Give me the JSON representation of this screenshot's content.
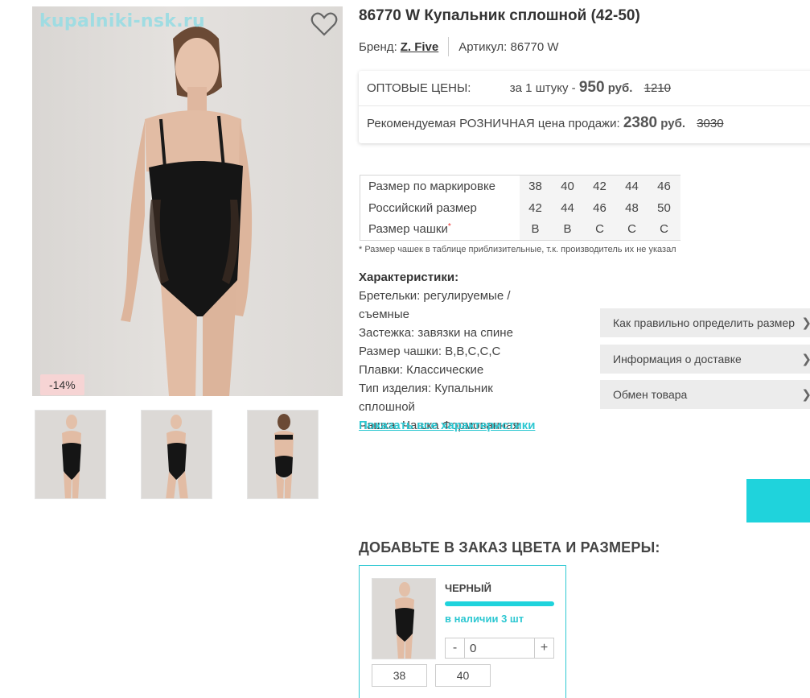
{
  "gallery": {
    "watermark": "kupalniki-nsk.ru",
    "discount_badge": "-14%",
    "thumbnails": [
      "front",
      "side",
      "back"
    ]
  },
  "product": {
    "title": "86770 W Купальник сплошной (42-50)",
    "brand_label": "Бренд:",
    "brand_name": "Z. Five",
    "article_label": "Артикул: 86770 W"
  },
  "prices": {
    "wholesale_label": "ОПТОВЫЕ ЦЕНЫ:",
    "wholesale_per": "за 1 штуку -",
    "wholesale_value": "950",
    "currency": "руб.",
    "wholesale_old": "1210",
    "retail_label": "Рекомендуемая РОЗНИЧНАЯ цена продажи:",
    "retail_value": "2380",
    "retail_old": "3030"
  },
  "size_table": {
    "rows": [
      {
        "label": "Размер по маркировке",
        "values": [
          "38",
          "40",
          "42",
          "44",
          "46"
        ]
      },
      {
        "label": "Российский размер",
        "values": [
          "42",
          "44",
          "46",
          "48",
          "50"
        ]
      },
      {
        "label": "Размер чашки",
        "star": "*",
        "values": [
          "B",
          "B",
          "C",
          "C",
          "C"
        ]
      }
    ],
    "note": "* Размер чашек в таблице приблизительные, т.к. производитель их не указал"
  },
  "characteristics": {
    "title": "Характеристики:",
    "items": [
      "Бретельки: регулируемые / съемные",
      "Застежка: завязки на спине",
      "Размер чашки: B,B,C,C,C",
      "Плавки: Классические",
      "Тип изделия: Купальник сплошной",
      "Чашка: Чашка Формованная"
    ],
    "show_all": "Показать все характеристики"
  },
  "side_buttons": [
    {
      "label": "Как правильно определить размер"
    },
    {
      "label": "Информация о доставке"
    },
    {
      "label": "Обмен товара"
    }
  ],
  "order": {
    "title": "ДОБАВЬТЕ В ЗАКАЗ ЦВЕТА И РАЗМЕРЫ:",
    "color_name": "ЧЕРНЫЙ",
    "stock": "в наличии 3 шт",
    "quantity": "0",
    "minus": "-",
    "plus": "+",
    "sizes": [
      "38",
      "40"
    ]
  },
  "colors": {
    "accent": "#2ec8d2",
    "discount_bg": "#f6d4d4"
  }
}
